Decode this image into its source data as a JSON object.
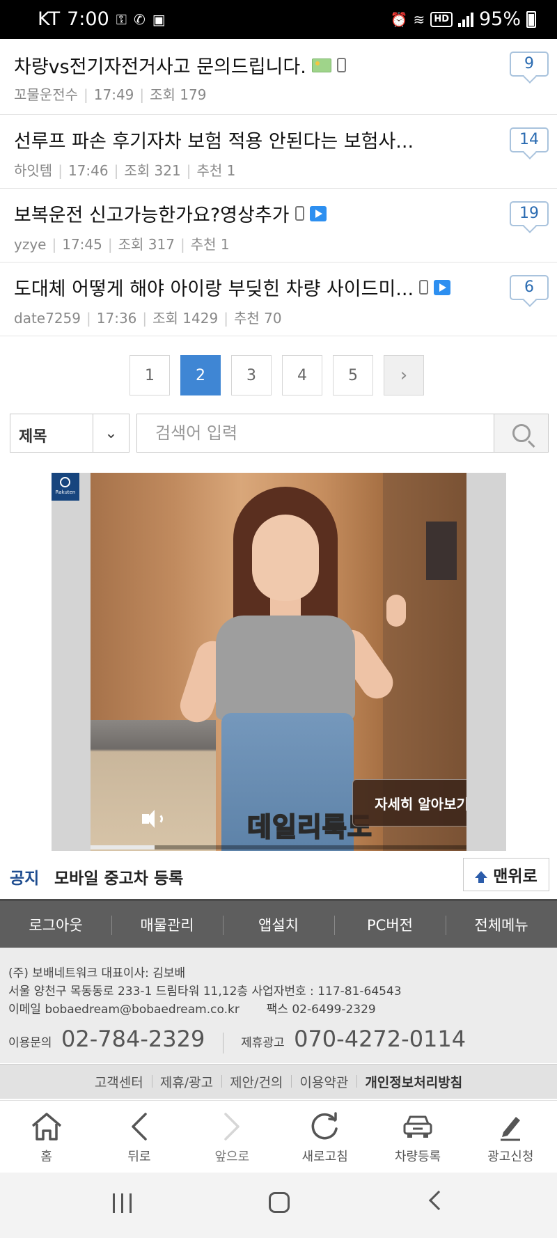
{
  "status_bar": {
    "carrier": "KT",
    "time": "7:00",
    "battery": "95%",
    "hd": "HD"
  },
  "posts": [
    {
      "title": "차량vs전기자전거사고 문의드립니다.",
      "author": "꼬물운전수",
      "time": "17:49",
      "views": "조회 179",
      "recommend": "",
      "comments": "9",
      "icons": [
        "image-icon",
        "mobile-icon"
      ]
    },
    {
      "title": "선루프 파손 후기자차 보험 적용 안된다는 보험사...",
      "author": "하잇템",
      "time": "17:46",
      "views": "조회 321",
      "recommend": "추천 1",
      "comments": "14",
      "icons": []
    },
    {
      "title": "보복운전 신고가능한가요?영상추가",
      "author": "yzye",
      "time": "17:45",
      "views": "조회 317",
      "recommend": "추천 1",
      "comments": "19",
      "icons": [
        "mobile-icon",
        "video-icon"
      ]
    },
    {
      "title": "도대체 어떻게 해야 아이랑 부딪힌 차량 사이드미...",
      "author": "date7259",
      "time": "17:36",
      "views": "조회 1429",
      "recommend": "추천 70",
      "comments": "6",
      "icons": [
        "mobile-icon",
        "video-icon"
      ]
    }
  ],
  "pagination": {
    "pages": [
      "1",
      "2",
      "3",
      "4",
      "5"
    ],
    "current": "2",
    "next": "›"
  },
  "search": {
    "select_value": "제목",
    "placeholder": "검색어 입력"
  },
  "ad": {
    "caption": "데일리룩도",
    "cta": "자세히 알아보기",
    "logo_text": "Rakuten",
    "progress": 0.17
  },
  "notice": {
    "label": "공지",
    "text": "모바일 중고차 등록",
    "top_button": "맨위로"
  },
  "footer_nav": [
    "로그아웃",
    "매물관리",
    "앱설치",
    "PC버전",
    "전체메뉴"
  ],
  "company": {
    "line1": "(주) 보배네트워크 대표이사: 김보배",
    "line2": "서울 양천구 목동동로 233-1 드림타워 11,12층 사업자번호 : 117-81-64543",
    "line3_email": "이메일 bobaedream@bobaedream.co.kr",
    "line3_fax": "팩스 02-6499-2329",
    "inquiry_label": "이용문의",
    "inquiry_phone": "02-784-2329",
    "partner_label": "제휴광고",
    "partner_phone": "070-4272-0114"
  },
  "footer_links": [
    "고객센터",
    "제휴/광고",
    "제안/건의",
    "이용약관",
    "개인정보처리방침"
  ],
  "browser_bar": [
    {
      "label": "홈",
      "icon": "home-icon"
    },
    {
      "label": "뒤로",
      "icon": "back-icon"
    },
    {
      "label": "앞으로",
      "icon": "forward-icon"
    },
    {
      "label": "새로고침",
      "icon": "refresh-icon"
    },
    {
      "label": "차량등록",
      "icon": "car-icon"
    },
    {
      "label": "광고신청",
      "icon": "pen-icon"
    }
  ]
}
